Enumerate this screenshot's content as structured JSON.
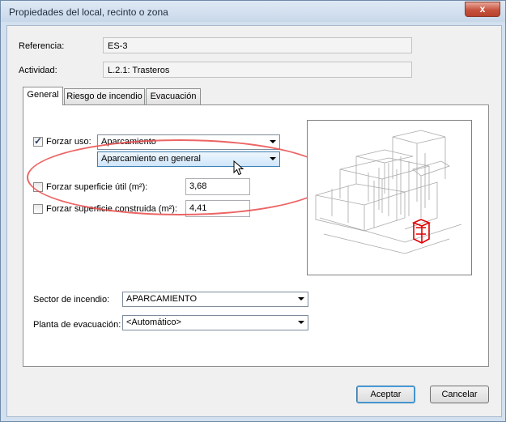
{
  "window": {
    "title": "Propiedades del local, recinto o zona",
    "close_glyph": "x"
  },
  "referencia": {
    "label": "Referencia:",
    "value": "ES-3"
  },
  "actividad": {
    "label": "Actividad:",
    "value": "L.2.1: Trasteros"
  },
  "tabs": [
    {
      "label": "General",
      "active": true
    },
    {
      "label": "Riesgo de incendio",
      "active": false
    },
    {
      "label": "Evacuación",
      "active": false
    }
  ],
  "forzar_uso": {
    "label": "Forzar uso:",
    "checked": true,
    "value": "Aparcamiento",
    "sub_value": "Aparcamiento en general"
  },
  "superficie_util": {
    "label": "Forzar superficie útil (m²):",
    "checked": false,
    "value": "3,68"
  },
  "superficie_construida": {
    "label": "Forzar superficie construida (m²):",
    "checked": false,
    "value": "4,41"
  },
  "sector_incendio": {
    "label": "Sector de incendio:",
    "value": "APARCAMIENTO"
  },
  "planta_evacuacion": {
    "label": "Planta de evacuación:",
    "value": "<Automático>"
  },
  "buttons": {
    "accept": "Aceptar",
    "cancel": "Cancelar"
  },
  "colors": {
    "highlight": "#e94a4a",
    "selected_element": "#e00000"
  }
}
